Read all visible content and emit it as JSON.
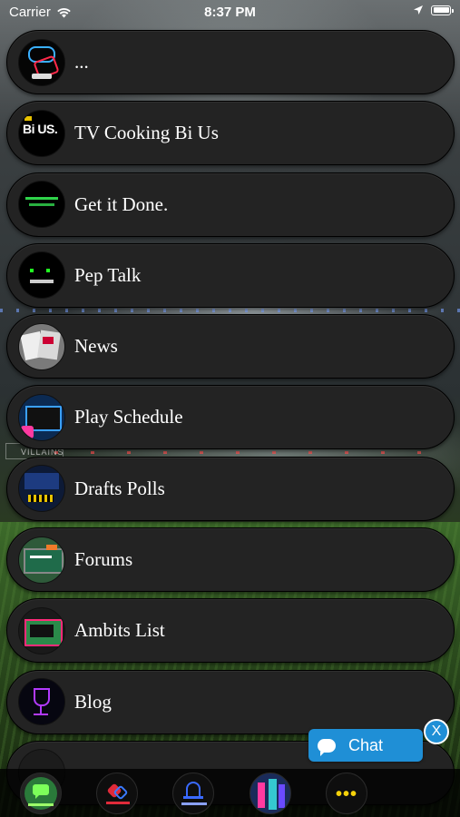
{
  "status_bar": {
    "carrier": "Carrier",
    "time": "8:37 PM"
  },
  "menu": {
    "items": [
      {
        "label": "...",
        "icon": "shop-logo-thumbnail"
      },
      {
        "label": "TV Cooking Bi Us",
        "icon": "tv-cooking-logo-thumbnail"
      },
      {
        "label": "Get it Done.",
        "icon": "halftime-fitness-thumbnail"
      },
      {
        "label": "Pep Talk",
        "icon": "pep-talk-thumbnail"
      },
      {
        "label": "News",
        "icon": "newspaper-thumbnail"
      },
      {
        "label": "Play Schedule",
        "icon": "play-schedule-thumbnail"
      },
      {
        "label": "Drafts Polls",
        "icon": "drafts-polls-thumbnail"
      },
      {
        "label": "Forums",
        "icon": "forums-thumbnail"
      },
      {
        "label": "Ambits List",
        "icon": "ambits-list-thumbnail"
      },
      {
        "label": "Blog",
        "icon": "blog-glass-thumbnail"
      },
      {
        "label": "",
        "icon": "partial-item-thumbnail"
      }
    ]
  },
  "tab_bar": {
    "tabs": [
      {
        "icon": "chat-bubble-icon"
      },
      {
        "icon": "hearts-icon"
      },
      {
        "icon": "bell-icon"
      },
      {
        "icon": "photo-icon"
      },
      {
        "icon": "more-dots-icon"
      }
    ]
  },
  "chat_widget": {
    "label": "Chat",
    "close": "X",
    "color": "#1f8fd6"
  },
  "background": {
    "sign_text": "VILLAINS"
  },
  "colors": {
    "row_bg": "#232323",
    "text": "#ffffff",
    "more_dots": "#f5d10a"
  }
}
